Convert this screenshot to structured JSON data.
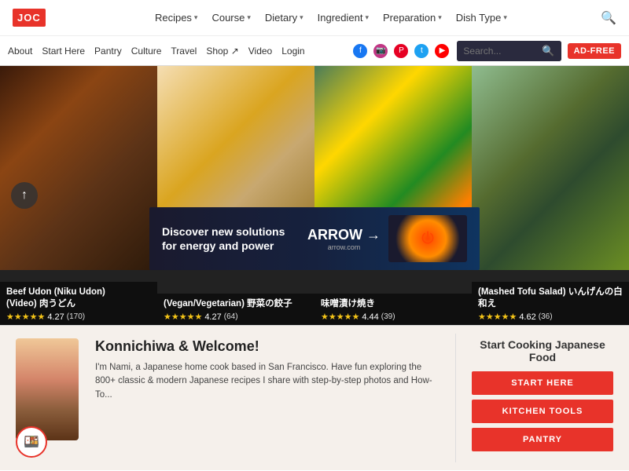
{
  "logo": {
    "text": "JOC"
  },
  "topNav": {
    "links": [
      {
        "label": "Recipes",
        "hasArrow": true
      },
      {
        "label": "Course",
        "hasArrow": true
      },
      {
        "label": "Dietary",
        "hasArrow": true
      },
      {
        "label": "Ingredient",
        "hasArrow": true
      },
      {
        "label": "Preparation",
        "hasArrow": true
      },
      {
        "label": "Dish Type",
        "hasArrow": true
      }
    ]
  },
  "secondaryNav": {
    "links": [
      "About",
      "Start Here",
      "Pantry",
      "Culture",
      "Travel",
      "Shop ↗",
      "Video",
      "Login"
    ],
    "searchPlaceholder": "Search...",
    "adFreeLabel": "AD-FREE"
  },
  "foodCards": [
    {
      "title": "Beef Udon (Niku Udon)\n(Video) 肉うどん",
      "rating": "4.27",
      "stars": "★★★★★",
      "reviewCount": "(170)",
      "colorClass": "food-1"
    },
    {
      "title": "(Vegan/Vegetarian) 野菜の餃子",
      "rating": "4.27",
      "stars": "★★★★★",
      "reviewCount": "(64)",
      "colorClass": "food-2"
    },
    {
      "title": "味噌漬け焼き",
      "rating": "4.44",
      "stars": "★★★★★",
      "reviewCount": "(39)",
      "colorClass": "food-3"
    },
    {
      "title": "(Mashed Tofu Salad) いんげんの白和え",
      "rating": "4.62",
      "stars": "★★★★★",
      "reviewCount": "(36)",
      "colorClass": "food-4"
    }
  ],
  "ad": {
    "headline": "Discover new solutions\nfor energy and power",
    "logoText": "ARROW →",
    "logoSub": "arrow.com"
  },
  "welcome": {
    "title": "Konnichiwa & Welcome!",
    "body": "I'm Nami, a Japanese home cook based in San Francisco. Have fun exploring the 800+ classic & modern Japanese recipes I share with step-by-step photos and How-To..."
  },
  "startCooking": {
    "title": "Start Cooking Japanese Food",
    "buttons": [
      "START HERE",
      "KITCHEN TOOLS",
      "PANTRY"
    ]
  }
}
